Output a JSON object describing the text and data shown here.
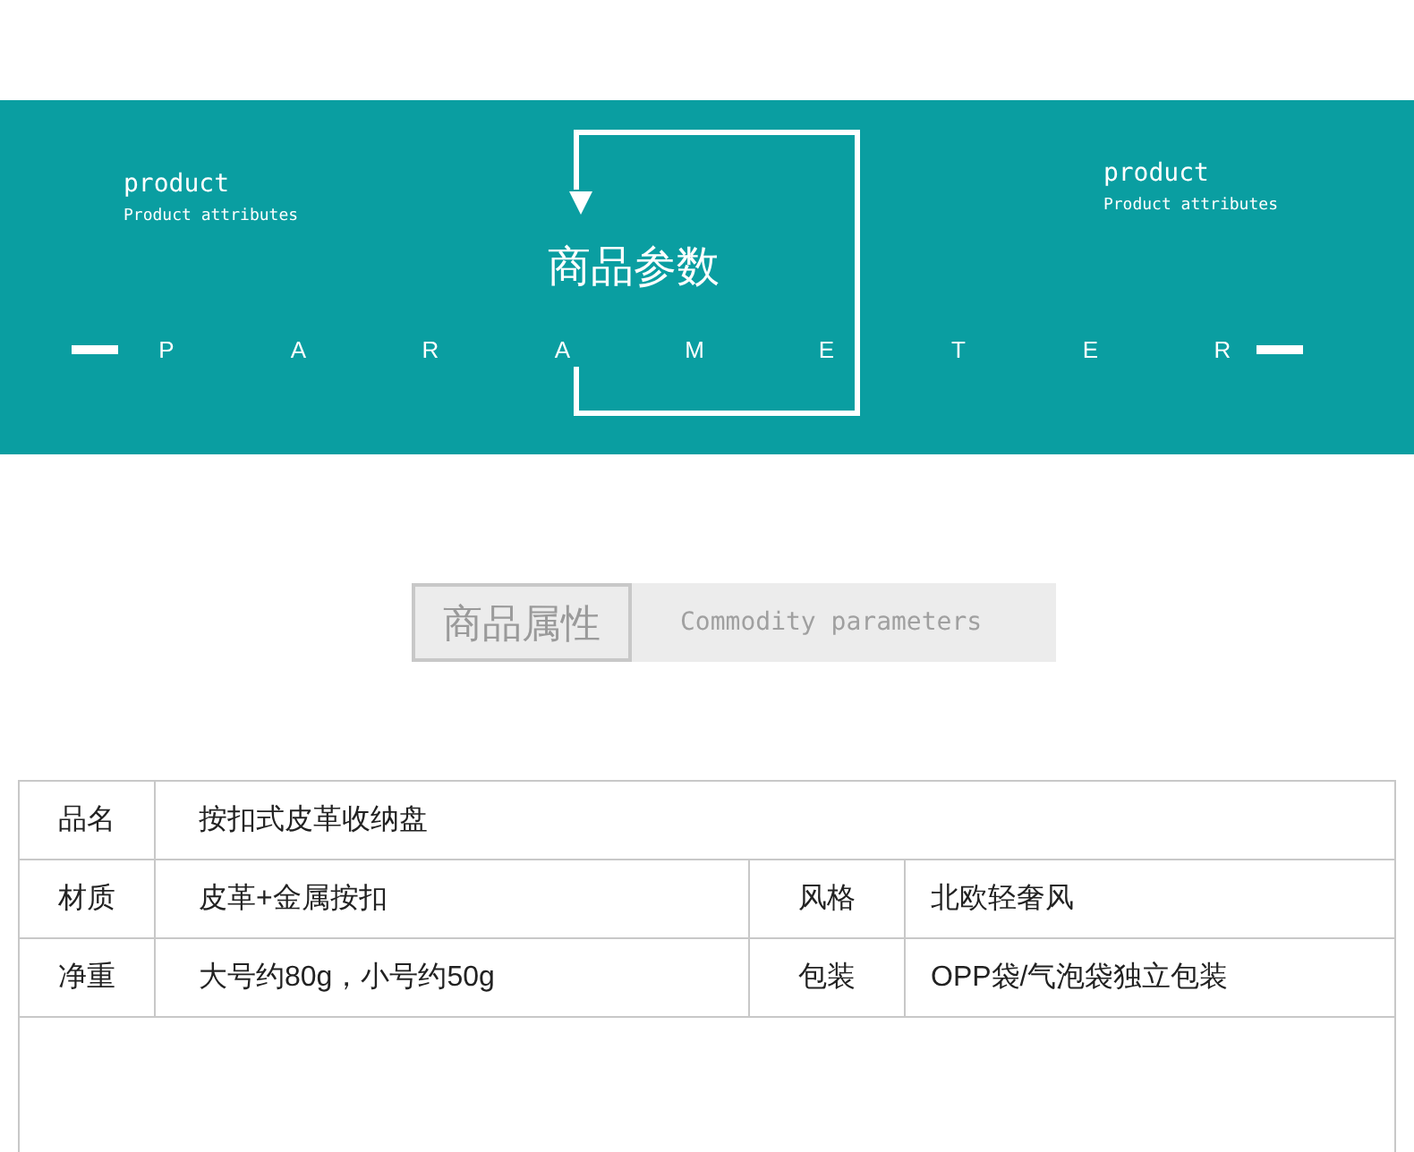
{
  "banner": {
    "left": {
      "title": "product",
      "subtitle": "Product attributes"
    },
    "right": {
      "title": "product",
      "subtitle": "Product attributes"
    },
    "heading": "商品参数",
    "letters": [
      "P",
      "A",
      "R",
      "A",
      "M",
      "E",
      "T",
      "E",
      "R"
    ]
  },
  "section": {
    "title": "商品属性",
    "subtitle": "Commodity parameters"
  },
  "table": {
    "rows": [
      {
        "cells": [
          "品名",
          "按扣式皮革收纳盘"
        ]
      },
      {
        "cells": [
          "材质",
          "皮革+金属按扣",
          "风格",
          "北欧轻奢风"
        ]
      },
      {
        "cells": [
          "净重",
          "大号约80g，小号约50g",
          "包装",
          "OPP袋/气泡袋独立包装"
        ]
      }
    ]
  }
}
